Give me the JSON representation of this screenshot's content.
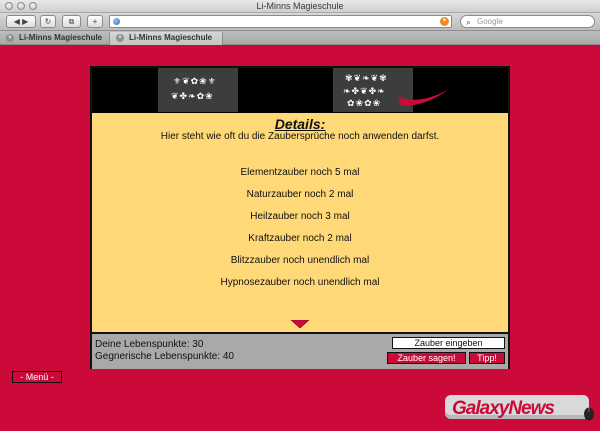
{
  "window": {
    "title": "Li-Minns Magieschule"
  },
  "toolbar": {
    "back_icon": "back-arrow-icon",
    "forward_icon": "forward-arrow-icon",
    "reload_icon": "reload-icon",
    "url_value": "",
    "search_placeholder": "Google"
  },
  "tabs": [
    {
      "label": "Li-Minns Magieschule",
      "active": false
    },
    {
      "label": "Li-Minns Magieschule",
      "active": true
    }
  ],
  "game": {
    "details_title": "Details:",
    "details_subtitle": "Hier steht wie oft du die Zaubersprüche noch anwenden darfst.",
    "spells": [
      "Elementzauber noch 5 mal",
      "Naturzauber noch 2 mal",
      "Heilzauber noch 3 mal",
      "Kraftzauber noch 2 mal",
      "Blitzzauber noch unendlich mal",
      "Hypnosezauber noch unendlich mal"
    ],
    "life_points": "Deine Lebenspunkte: 30",
    "enemy_life_points": "Gegnerische Lebenspunkte: 40",
    "spell_input_value": "Zauber eingeben",
    "cast_button": "Zauber sagen!",
    "hint_button": "Tipp!"
  },
  "page": {
    "menu_button": "- Menü -"
  },
  "watermark": {
    "text": "GalaxyNews"
  },
  "colors": {
    "page_bg": "#cb0a3a",
    "panel_bg": "#ffd978",
    "status_bg": "#a9a9a9"
  }
}
